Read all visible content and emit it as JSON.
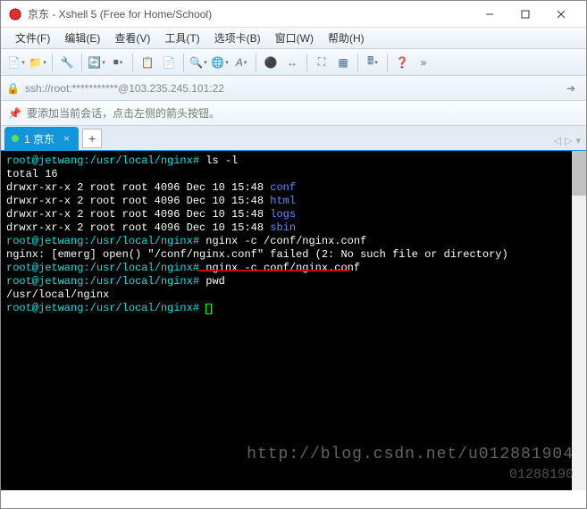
{
  "title": "京东 - Xshell 5 (Free for Home/School)",
  "menu": {
    "file": "文件(F)",
    "edit": "编辑(E)",
    "view": "查看(V)",
    "tools": "工具(T)",
    "tab": "选项卡(B)",
    "window": "窗口(W)",
    "help": "帮助(H)"
  },
  "address": "ssh://root:***********@103.235.245.101:22",
  "infobar": "要添加当前会话，点击左侧的箭头按钮。",
  "tab": {
    "label": "1 京东"
  },
  "terminal": {
    "prompt": "root@jetwang:/usr/local/nginx#",
    "lines": [
      {
        "prompt": true,
        "cmd": " ls -l"
      },
      {
        "text": "total 16"
      },
      {
        "perm": "drwxr-xr-x 2 root root 4096 Dec 10 15:48 ",
        "dir": "conf"
      },
      {
        "perm": "drwxr-xr-x 2 root root 4096 Dec 10 15:48 ",
        "dir": "html"
      },
      {
        "perm": "drwxr-xr-x 2 root root 4096 Dec 10 15:48 ",
        "dir": "logs"
      },
      {
        "perm": "drwxr-xr-x 2 root root 4096 Dec 10 15:48 ",
        "dir": "sbin"
      },
      {
        "prompt": true,
        "cmd": " nginx -c /conf/nginx.conf"
      },
      {
        "text": "nginx: [emerg] open() \"/conf/nginx.conf\" failed (2: No such file or directory)"
      },
      {
        "prompt": true,
        "cmd": " nginx -c conf/nginx.conf",
        "ul": true
      },
      {
        "prompt": true,
        "cmd": " pwd"
      },
      {
        "text": "/usr/local/nginx"
      },
      {
        "prompt": true,
        "cmd": " ",
        "cursor": true
      }
    ]
  },
  "watermark1": "http://blog.csdn.net/u012881904",
  "watermark2": "01288190"
}
